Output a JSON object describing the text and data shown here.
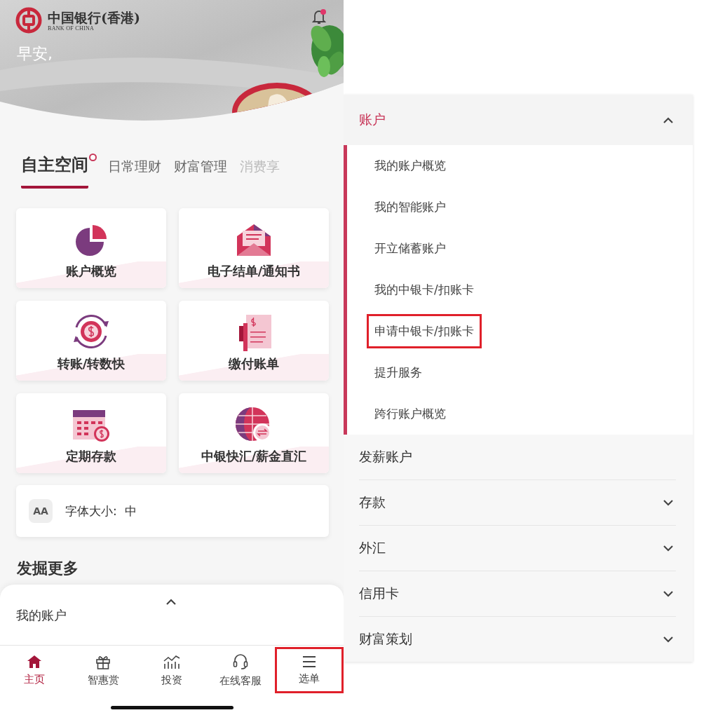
{
  "header": {
    "logo_cn": "中国银行(香港)",
    "logo_en": "BANK OF CHINA",
    "greeting": "早安,",
    "notification_badge": true
  },
  "tabs": [
    {
      "label": "自主空间",
      "selected": true,
      "badge": true
    },
    {
      "label": "日常理财",
      "selected": false,
      "badge": false
    },
    {
      "label": "财富管理",
      "selected": false,
      "badge": false
    },
    {
      "label": "消费享",
      "selected": false,
      "badge": false
    }
  ],
  "tiles": [
    {
      "label": "账户概览"
    },
    {
      "label": "电子结单/通知书"
    },
    {
      "label": "转账/转数快"
    },
    {
      "label": "缴付账单"
    },
    {
      "label": "定期存款"
    },
    {
      "label": "中银快汇/薪金直汇"
    }
  ],
  "font_size": {
    "icon_text": "AA",
    "label": "字体大小:",
    "value": "中"
  },
  "section_title": "发掘更多",
  "bottom_sheet": {
    "title": "我的账户"
  },
  "nav": [
    {
      "label": "主页",
      "selected": true,
      "highlighted": false
    },
    {
      "label": "智惠赏",
      "selected": false,
      "highlighted": false
    },
    {
      "label": "投资",
      "selected": false,
      "highlighted": false
    },
    {
      "label": "在线客服",
      "selected": false,
      "highlighted": false
    },
    {
      "label": "选单",
      "selected": false,
      "highlighted": true
    }
  ],
  "menu": [
    {
      "label": "账户",
      "kind": "group",
      "selected": true,
      "expanded": true,
      "children": [
        {
          "label": "我的账户概览",
          "highlighted": false
        },
        {
          "label": "我的智能账户",
          "highlighted": false
        },
        {
          "label": "开立储蓄账户",
          "highlighted": false
        },
        {
          "label": "我的中银卡/扣账卡",
          "highlighted": false
        },
        {
          "label": "申请中银卡/扣账卡",
          "highlighted": true
        },
        {
          "label": "提升服务",
          "highlighted": false
        },
        {
          "label": "跨行账户概览",
          "highlighted": false
        }
      ]
    },
    {
      "label": "发薪账户",
      "kind": "link",
      "selected": false,
      "expanded": false
    },
    {
      "label": "存款",
      "kind": "group",
      "selected": false,
      "expanded": false
    },
    {
      "label": "外汇",
      "kind": "group",
      "selected": false,
      "expanded": false
    },
    {
      "label": "信用卡",
      "kind": "group",
      "selected": false,
      "expanded": false
    },
    {
      "label": "财富策划",
      "kind": "group",
      "selected": false,
      "expanded": false
    }
  ]
}
